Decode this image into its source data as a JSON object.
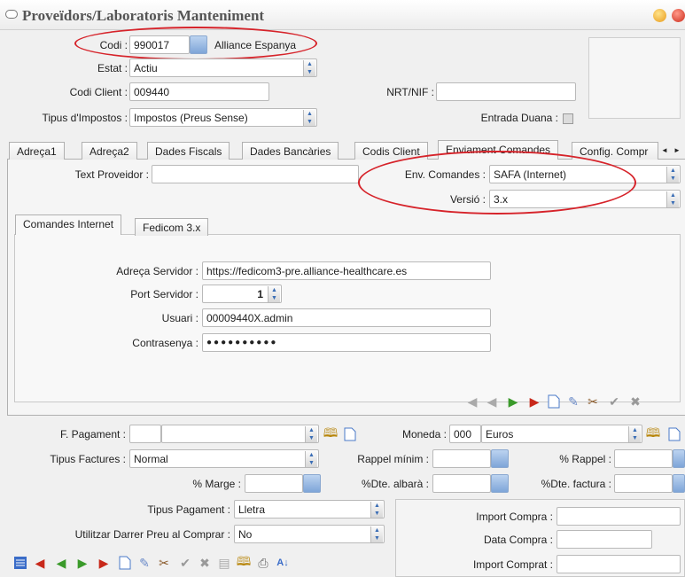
{
  "window": {
    "title": "Proveïdors/Laboratoris Manteniment"
  },
  "header": {
    "codi_label": "Codi :",
    "codi_value": "990017",
    "codi_name": "Alliance Espanya",
    "estat_label": "Estat :",
    "estat_value": "Actiu",
    "codi_client_label": "Codi Client :",
    "codi_client_value": "009440",
    "nrt_label": "NRT/NIF :",
    "nrt_value": "",
    "tipus_impostos_label": "Tipus d'Impostos :",
    "tipus_impostos_value": "Impostos (Preus Sense)",
    "entrada_duana_label": "Entrada Duana :"
  },
  "tabs": [
    "Adreça1",
    "Adreça2",
    "Dades Fiscals",
    "Dades Bancàries",
    "Codis Client",
    "Enviament Comandes",
    "Config. Compr"
  ],
  "enviament": {
    "text_proveidor_label": "Text Proveidor :",
    "env_comandes_label": "Env. Comandes :",
    "env_comandes_value": "SAFA (Internet)",
    "versio_label": "Versió :",
    "versio_value": "3.x",
    "subtabs": [
      "Comandes Internet",
      "Fedicom 3.x"
    ],
    "adreca_servidor_label": "Adreça Servidor :",
    "adreca_servidor_value": "https://fedicom3-pre.alliance-healthcare.es",
    "port_servidor_label": "Port Servidor :",
    "port_servidor_value": "1",
    "usuari_label": "Usuari :",
    "usuari_value": "00009440X.admin",
    "contrasenya_label": "Contrasenya :",
    "contrasenya_value": "●●●●●●●●●●"
  },
  "bottom": {
    "f_pagament_label": "F. Pagament :",
    "moneda_label": "Moneda :",
    "moneda_code": "000",
    "moneda_value": "Euros",
    "tipus_factures_label": "Tipus Factures :",
    "tipus_factures_value": "Normal",
    "rappel_minim_label": "Rappel mínim :",
    "rappel_pct_label": "% Rappel :",
    "marge_label": "% Marge :",
    "dte_albara_label": "%Dte. albarà :",
    "dte_factura_label": "%Dte. factura :",
    "tipus_pagament_label": "Tipus Pagament :",
    "tipus_pagament_value": "Lletra",
    "utilitzar_label": "Utilitzar Darrer Preu al Comprar :",
    "utilitzar_value": "No",
    "import_compra_label": "Import Compra :",
    "data_compra_label": "Data Compra :",
    "import_comprat_label": "Import Comprat :"
  }
}
